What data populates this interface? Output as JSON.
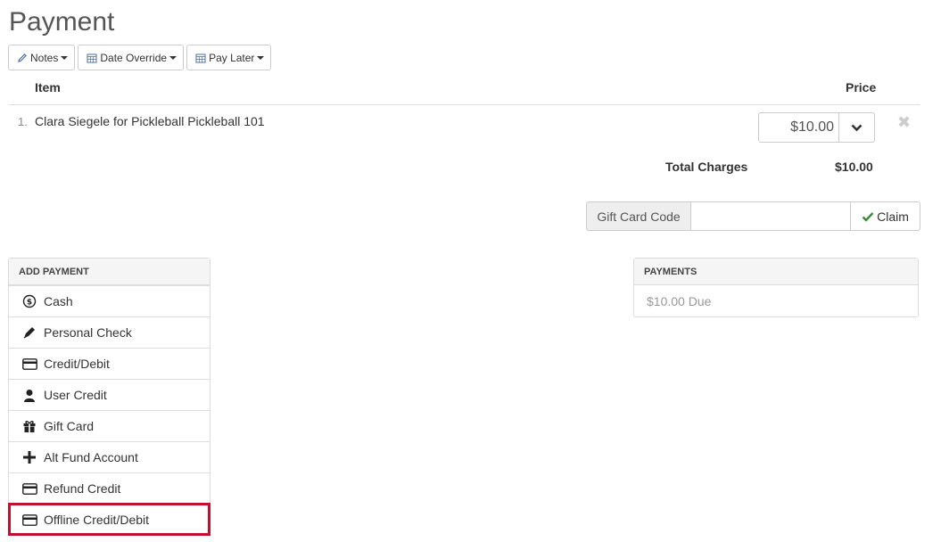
{
  "page": {
    "title": "Payment"
  },
  "toolbar": {
    "notes_label": "Notes",
    "date_override_label": "Date Override",
    "pay_later_label": "Pay Later"
  },
  "table": {
    "col_item": "Item",
    "col_price": "Price",
    "rows": [
      {
        "num": "1.",
        "description": "Clara Siegele for Pickleball Pickleball 101",
        "price": "$10.00"
      }
    ],
    "total_label": "Total Charges",
    "total_value": "$10.00"
  },
  "gift_card": {
    "addon_label": "Gift Card Code",
    "input_value": "",
    "claim_label": "Claim"
  },
  "add_payment": {
    "header": "ADD PAYMENT",
    "items": [
      {
        "label": "Cash",
        "icon": "dollar-circle-icon"
      },
      {
        "label": "Personal Check",
        "icon": "pen-icon"
      },
      {
        "label": "Credit/Debit",
        "icon": "credit-card-icon"
      },
      {
        "label": "User Credit",
        "icon": "user-icon"
      },
      {
        "label": "Gift Card",
        "icon": "gift-icon"
      },
      {
        "label": "Alt Fund Account",
        "icon": "plus-icon"
      },
      {
        "label": "Refund Credit",
        "icon": "credit-card-icon"
      },
      {
        "label": "Offline Credit/Debit",
        "icon": "credit-card-icon",
        "highlighted": true
      }
    ]
  },
  "payments": {
    "header": "PAYMENTS",
    "due_text": "$10.00 Due"
  },
  "colors": {
    "highlight": "#c0102b",
    "claim_check": "#3c8b3c",
    "icon_blue": "#4a6fa5"
  }
}
